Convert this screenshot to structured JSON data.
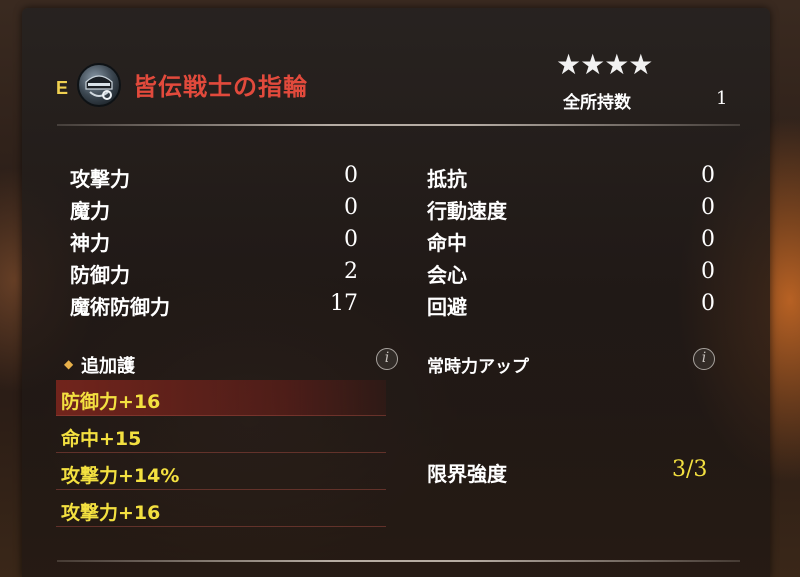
{
  "item": {
    "rank_letter": "E",
    "name": "皆伝戦士の指輪",
    "stars": "★★★★",
    "owned_label": "全所持数",
    "owned_value": "1"
  },
  "stats_left": [
    {
      "label": "攻撃力",
      "value": "0"
    },
    {
      "label": "魔力",
      "value": "0"
    },
    {
      "label": "神力",
      "value": "0"
    },
    {
      "label": "防御力",
      "value": "2"
    },
    {
      "label": "魔術防御力",
      "value": "17"
    }
  ],
  "stats_right": [
    {
      "label": "抵抗",
      "value": "0"
    },
    {
      "label": "行動速度",
      "value": "0"
    },
    {
      "label": "命中",
      "value": "0"
    },
    {
      "label": "会心",
      "value": "0"
    },
    {
      "label": "回避",
      "value": "0"
    }
  ],
  "bonus": {
    "title": "追加護",
    "info_glyph": "i",
    "items": [
      "防御力+16",
      "命中+15",
      "攻撃力+14%",
      "攻撃力+16"
    ]
  },
  "power_up": {
    "title": "常時力アップ",
    "info_glyph": "i"
  },
  "limit": {
    "label": "限界強度",
    "value": "3/3"
  },
  "icons": {
    "rank": "rank-letter-icon",
    "item": "ring-helmet-icon",
    "info": "info-icon",
    "bullet": "diamond-icon"
  }
}
